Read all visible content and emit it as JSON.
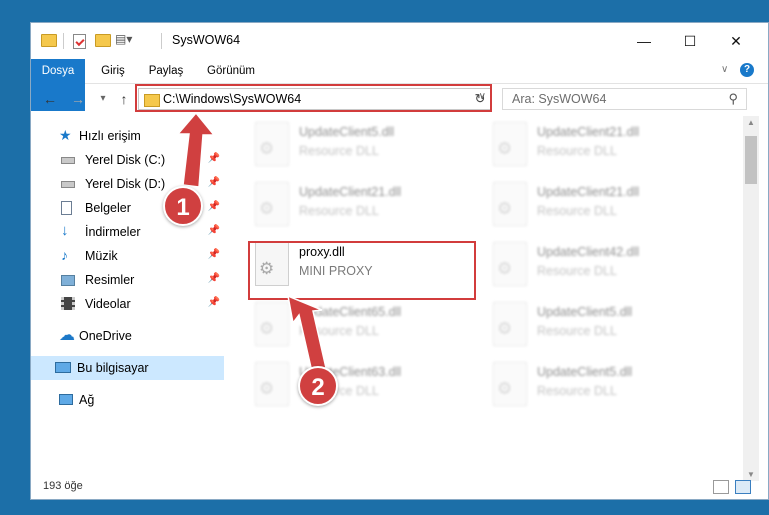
{
  "window": {
    "title": "SysWOW64",
    "controls": {
      "minimize": "—",
      "maximize": "☐",
      "close": "✕"
    }
  },
  "ribbon": {
    "tabs": [
      "Dosya",
      "Giriş",
      "Paylaş",
      "Görünüm"
    ],
    "expand_icon": "chevron-down-icon",
    "help_icon": "help-icon"
  },
  "nav": {
    "back": "←",
    "forward": "→",
    "recent": "▾",
    "up": "↑",
    "address": "C:\\Windows\\SysWOW64",
    "dropdown": "∨",
    "refresh": "↻",
    "search_placeholder": "Ara: SysWOW64",
    "search_glyph": "⚲"
  },
  "sidebar": {
    "quick_access": "Hızlı erişim",
    "items": [
      {
        "label": "Yerel Disk (C:)",
        "pinned": true
      },
      {
        "label": "Yerel Disk (D:)",
        "pinned": true
      },
      {
        "label": "Belgeler",
        "pinned": true
      },
      {
        "label": "İndirmeler",
        "pinned": true
      },
      {
        "label": "Müzik",
        "pinned": true
      },
      {
        "label": "Resimler",
        "pinned": true
      },
      {
        "label": "Videolar",
        "pinned": true
      }
    ],
    "onedrive": "OneDrive",
    "this_pc": "Bu bilgisayar",
    "network": "Ağ",
    "pin_glyph": "📌"
  },
  "files": [
    {
      "name": "UpdateClient5.dll",
      "desc": "Resource DLL",
      "blurred": true
    },
    {
      "name": "UpdateClient21.dll",
      "desc": "Resource DLL",
      "blurred": true
    },
    {
      "name": "UpdateClient21.dll",
      "desc": "Resource DLL",
      "blurred": true
    },
    {
      "name": "UpdateClient21.dll",
      "desc": "Resource DLL",
      "blurred": true
    },
    {
      "name": "proxy.dll",
      "desc": "MINI PROXY",
      "blurred": false
    },
    {
      "name": "UpdateClient42.dll",
      "desc": "Resource DLL",
      "blurred": true
    },
    {
      "name": "UpdateClient65.dll",
      "desc": "Resource DLL",
      "blurred": true
    },
    {
      "name": "UpdateClient5.dll",
      "desc": "Resource DLL",
      "blurred": true
    },
    {
      "name": "UpdateClient63.dll",
      "desc": "Resource DLL",
      "blurred": true
    },
    {
      "name": "UpdateClient5.dll",
      "desc": "Resource DLL",
      "blurred": true
    }
  ],
  "status": {
    "item_count": "193 öğe"
  },
  "annotations": {
    "badge1": "1",
    "badge2": "2",
    "highlight_color": "#d23c3c"
  },
  "colors": {
    "accent": "#1979ca",
    "selection": "#cce8ff",
    "desktop": "#1c6fa8"
  }
}
